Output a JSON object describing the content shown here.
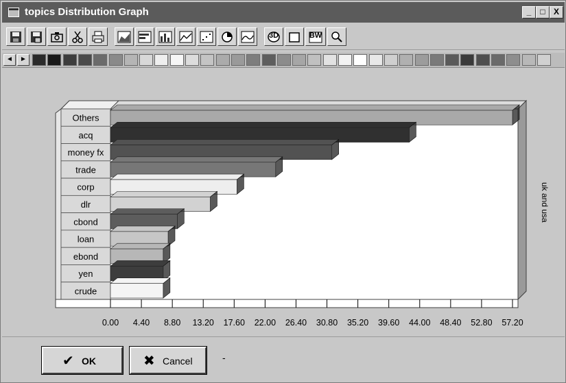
{
  "window": {
    "title": "topics Distribution Graph",
    "minimize_label": "_",
    "maximize_label": "□",
    "close_label": "X"
  },
  "toolbar": {
    "buttons": [
      {
        "icon": "save-icon"
      },
      {
        "icon": "save-as-icon"
      },
      {
        "icon": "camera-icon"
      },
      {
        "icon": "scissors-icon"
      },
      {
        "icon": "printer-icon"
      },
      {
        "icon": "area-chart-icon"
      },
      {
        "icon": "horizontal-bar-chart-icon"
      },
      {
        "icon": "bar-chart-icon"
      },
      {
        "icon": "line-chart-icon"
      },
      {
        "icon": "scatter-chart-icon"
      },
      {
        "icon": "pie-chart-icon"
      },
      {
        "icon": "curve-chart-icon"
      },
      {
        "icon": "3d-toggle-icon",
        "label": "3D"
      },
      {
        "icon": "frame-icon"
      },
      {
        "icon": "black-white-icon",
        "label": "BW"
      },
      {
        "icon": "zoom-icon"
      }
    ]
  },
  "palette": {
    "colors": [
      "#2b2b2b",
      "#1a1a1a",
      "#3c3c3c",
      "#4a4a4a",
      "#6b6b6b",
      "#8a8a8a",
      "#b5b5b5",
      "#d8d8d8",
      "#eeeeee",
      "#f6f6f6",
      "#dcdcdc",
      "#c4c4c4",
      "#ababab",
      "#9a9a9a",
      "#7d7d7d",
      "#5e5e5e",
      "#8c8c8c",
      "#a6a6a6",
      "#c0c0c0",
      "#e2e2e2",
      "#f2f2f2",
      "#ffffff",
      "#e8e8e8",
      "#cfcfcf",
      "#b0b0b0",
      "#9c9c9c",
      "#7a7a7a",
      "#5a5a5a",
      "#3a3a3a",
      "#4e4e4e",
      "#6a6a6a",
      "#8e8e8e",
      "#b8b8b8",
      "#d0d0d0"
    ]
  },
  "chart_data": {
    "type": "bar",
    "orientation": "horizontal",
    "view": "3d",
    "categories": [
      "Others",
      "acq",
      "money fx",
      "trade",
      "corp",
      "dlr",
      "cbond",
      "loan",
      "ebond",
      "yen",
      "crude"
    ],
    "values": [
      57.2,
      42.5,
      31.5,
      23.5,
      18.0,
      14.2,
      9.5,
      8.2,
      7.5,
      7.5,
      7.5
    ],
    "colors": [
      "#a9a9a9",
      "#303030",
      "#525252",
      "#777777",
      "#eeeeee",
      "#d2d2d2",
      "#5d5d5d",
      "#c6c6c6",
      "#b7b7b7",
      "#3d3d3d",
      "#f4f4f4"
    ],
    "xlim": [
      0,
      57.2
    ],
    "xticks": [
      "0.00",
      "4.40",
      "8.80",
      "13.20",
      "17.60",
      "22.00",
      "26.40",
      "30.80",
      "35.20",
      "39.60",
      "44.00",
      "48.40",
      "52.80",
      "57.20"
    ],
    "series_label": "uk and usa"
  },
  "buttons": {
    "ok_label": "OK",
    "cancel_label": "Cancel"
  },
  "status": "-"
}
